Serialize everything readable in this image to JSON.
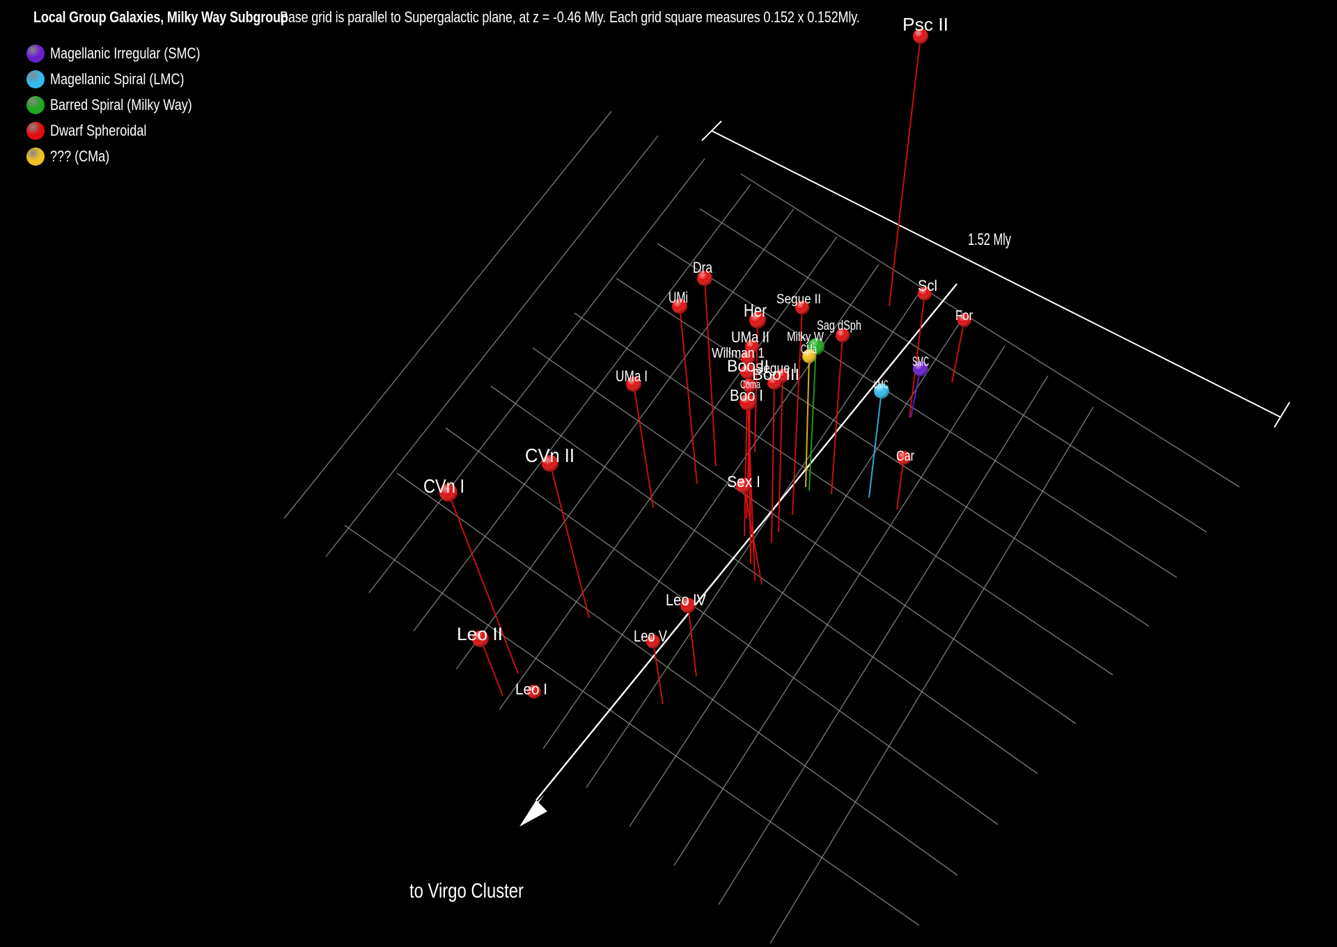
{
  "header": {
    "title": "Local Group Galaxies, Milky Way Subgroup",
    "subtitle": "Base grid is parallel to Supergalactic plane, at z = -0.46 Mly. Each grid square measures 0.152 x 0.152Mly."
  },
  "legend": [
    {
      "label": "Magellanic Irregular (SMC)",
      "color": "#6a1fd0"
    },
    {
      "label": "Magellanic Spiral (LMC)",
      "color": "#33bbf0"
    },
    {
      "label": "Barred Spiral (Milky Way)",
      "color": "#1ea81e"
    },
    {
      "label": "Dwarf Spheroidal",
      "color": "#e01010"
    },
    {
      "label": "??? (CMa)",
      "color": "#f0c020"
    }
  ],
  "scale_label": "1.52 Mly",
  "direction_label": "to Virgo Cluster",
  "galaxies": [
    {
      "name": "Psc II",
      "type": "Dwarf Spheroidal",
      "color": "#e01010"
    },
    {
      "name": "Dra",
      "type": "Dwarf Spheroidal",
      "color": "#e01010"
    },
    {
      "name": "UMi",
      "type": "Dwarf Spheroidal",
      "color": "#e01010"
    },
    {
      "name": "Her",
      "type": "Dwarf Spheroidal",
      "color": "#e01010"
    },
    {
      "name": "Segue II",
      "type": "Dwarf Spheroidal",
      "color": "#e01010"
    },
    {
      "name": "Sag dSph",
      "type": "Dwarf Spheroidal",
      "color": "#e01010"
    },
    {
      "name": "Milky Way",
      "type": "Barred Spiral",
      "color": "#1ea81e"
    },
    {
      "name": "CMa",
      "type": "???",
      "color": "#f0c020"
    },
    {
      "name": "UMa II",
      "type": "Dwarf Spheroidal",
      "color": "#e01010"
    },
    {
      "name": "Willman 1",
      "type": "Dwarf Spheroidal",
      "color": "#e01010"
    },
    {
      "name": "Boo II",
      "type": "Dwarf Spheroidal",
      "color": "#e01010"
    },
    {
      "name": "Segue I",
      "type": "Dwarf Spheroidal",
      "color": "#e01010"
    },
    {
      "name": "Coma",
      "type": "Dwarf Spheroidal",
      "color": "#e01010"
    },
    {
      "name": "Boo III",
      "type": "Dwarf Spheroidal",
      "color": "#e01010"
    },
    {
      "name": "Boo I",
      "type": "Dwarf Spheroidal",
      "color": "#e01010"
    },
    {
      "name": "UMa I",
      "type": "Dwarf Spheroidal",
      "color": "#e01010"
    },
    {
      "name": "Scl",
      "type": "Dwarf Spheroidal",
      "color": "#e01010"
    },
    {
      "name": "For",
      "type": "Dwarf Spheroidal",
      "color": "#e01010"
    },
    {
      "name": "SMC",
      "type": "Magellanic Irregular",
      "color": "#6a1fd0"
    },
    {
      "name": "LMC",
      "type": "Magellanic Spiral",
      "color": "#33bbf0"
    },
    {
      "name": "Car",
      "type": "Dwarf Spheroidal",
      "color": "#e01010"
    },
    {
      "name": "CVn II",
      "type": "Dwarf Spheroidal",
      "color": "#e01010"
    },
    {
      "name": "CVn I",
      "type": "Dwarf Spheroidal",
      "color": "#e01010"
    },
    {
      "name": "Sex",
      "type": "Dwarf Spheroidal",
      "color": "#e01010"
    },
    {
      "name": "Leo IV",
      "type": "Dwarf Spheroidal",
      "color": "#e01010"
    },
    {
      "name": "Leo V",
      "type": "Dwarf Spheroidal",
      "color": "#e01010"
    },
    {
      "name": "Leo II",
      "type": "Dwarf Spheroidal",
      "color": "#e01010"
    },
    {
      "name": "Leo I",
      "type": "Dwarf Spheroidal",
      "color": "#e01010"
    }
  ]
}
